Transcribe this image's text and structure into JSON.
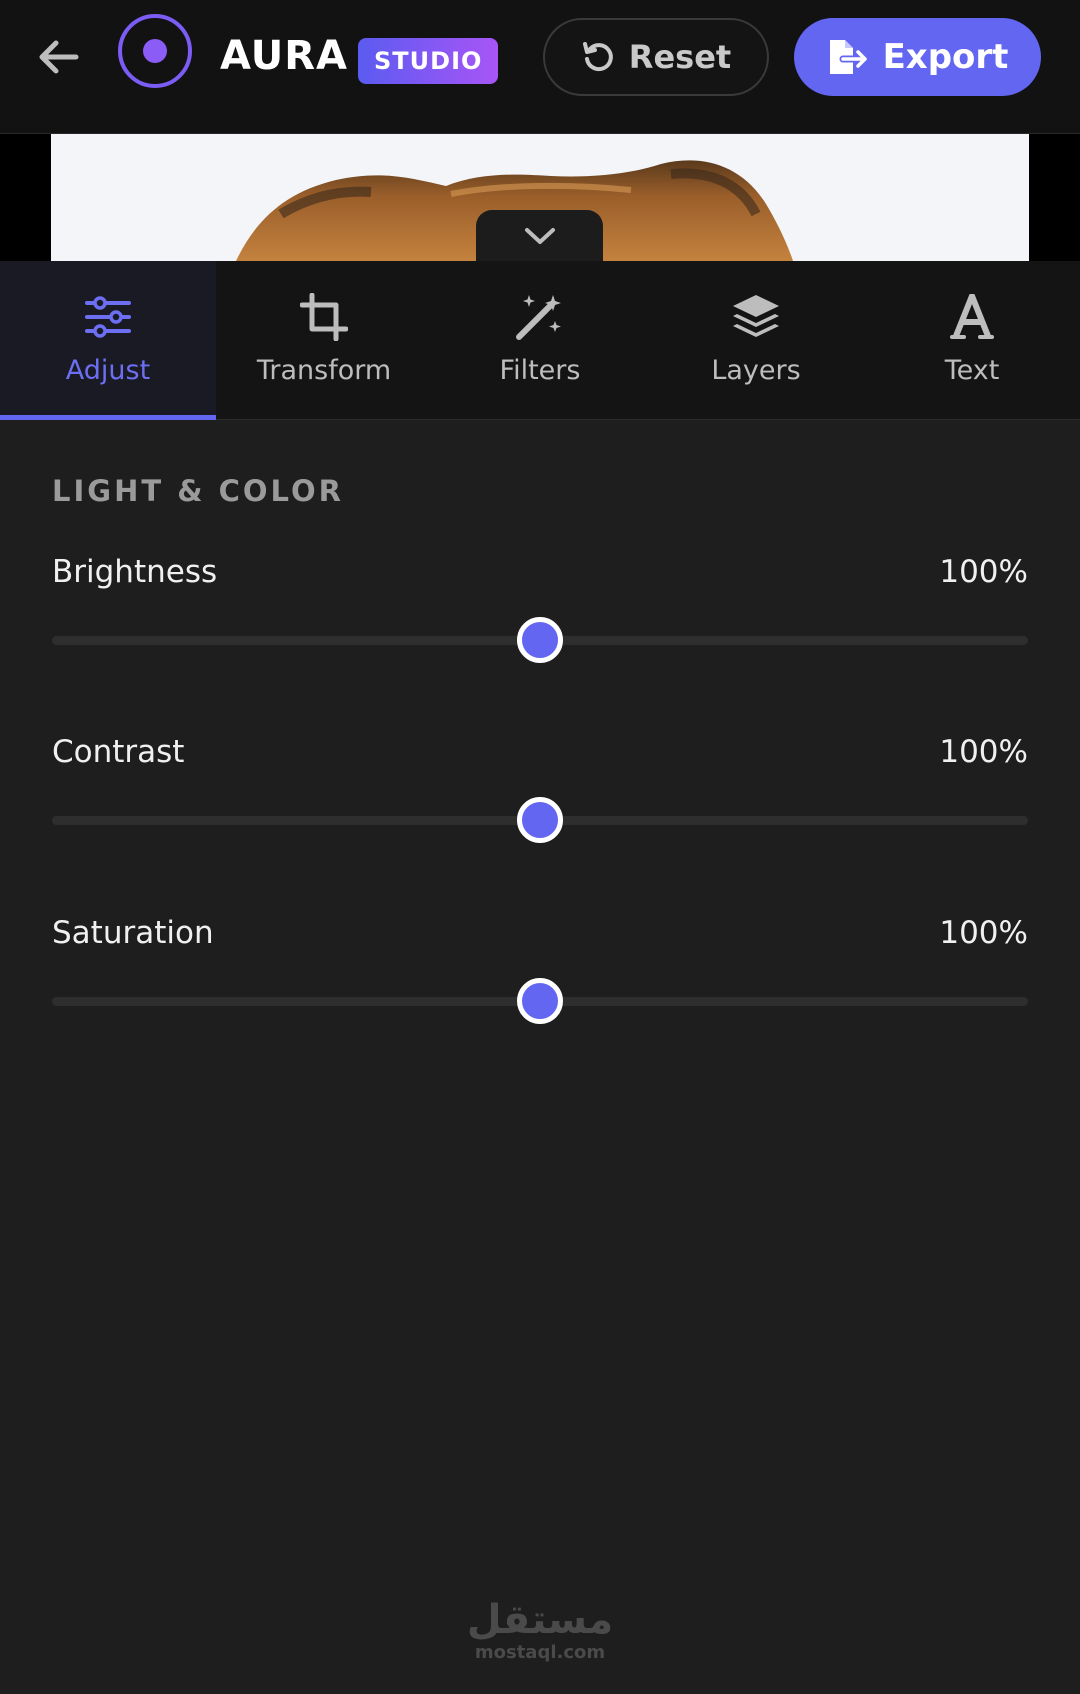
{
  "header": {
    "brand": "AURA",
    "badge": "STUDIO",
    "reset_label": "Reset",
    "export_label": "Export",
    "accent": "#6366f1"
  },
  "tabs": [
    {
      "label": "Adjust",
      "icon": "sliders-icon",
      "active": true
    },
    {
      "label": "Transform",
      "icon": "crop-icon",
      "active": false
    },
    {
      "label": "Filters",
      "icon": "magic-wand-icon",
      "active": false
    },
    {
      "label": "Layers",
      "icon": "layers-icon",
      "active": false
    },
    {
      "label": "Text",
      "icon": "text-icon",
      "active": false
    }
  ],
  "panel": {
    "section_title": "LIGHT & COLOR",
    "controls": [
      {
        "label": "Brightness",
        "value": "100%",
        "level": 0.5
      },
      {
        "label": "Contrast",
        "value": "100%",
        "level": 0.5
      },
      {
        "label": "Saturation",
        "value": "100%",
        "level": 0.5
      }
    ]
  },
  "watermark": {
    "arabic": "مستقل",
    "latin": "mostaql.com"
  }
}
